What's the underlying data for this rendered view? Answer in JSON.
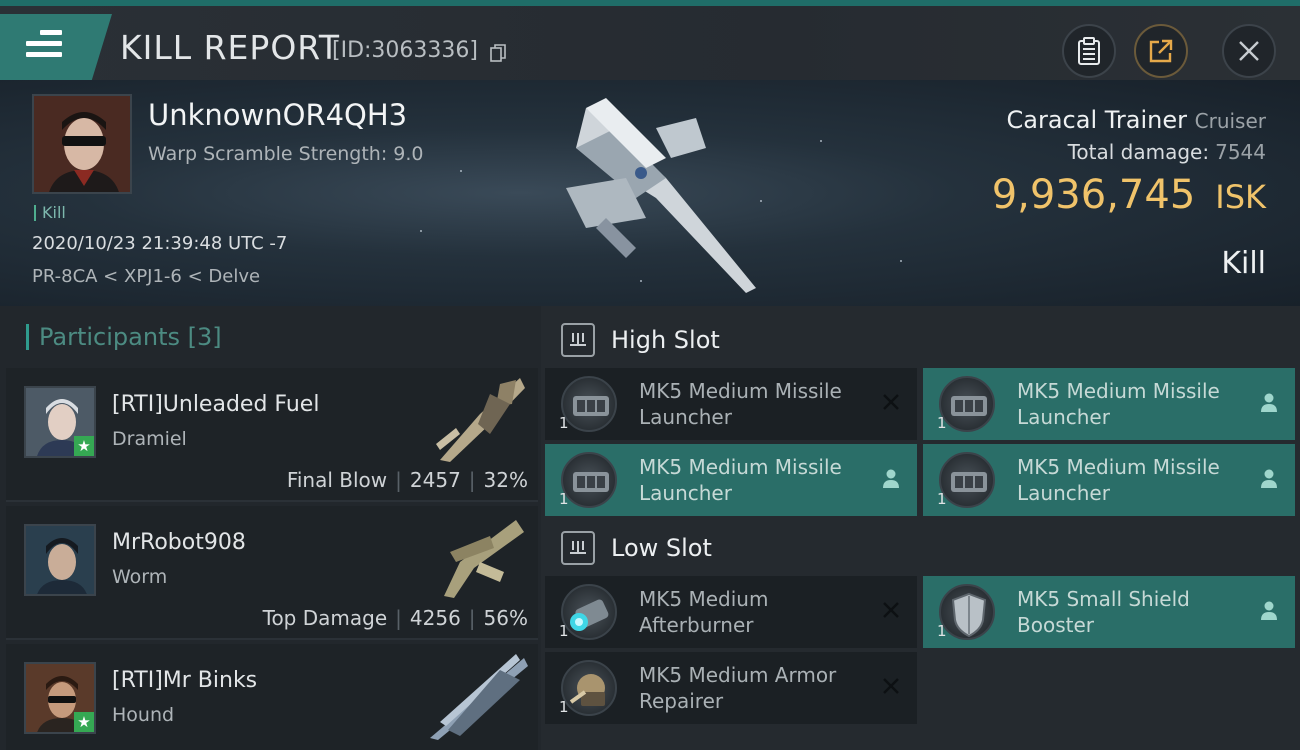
{
  "header": {
    "title": "KILL REPORT",
    "report_id": "[ID:3063336]"
  },
  "victim": {
    "name": "UnknownOR4QH3",
    "warp_scramble": "Warp Scramble Strength: 9.0",
    "tag": "Kill",
    "datetime": "2020/10/23 21:39:48 UTC -7",
    "location": "PR-8CA < XPJ1-6 < Delve",
    "ship_name": "Caracal Trainer",
    "ship_class": "Cruiser",
    "total_damage_label": "Total damage:",
    "total_damage": "7544",
    "isk_value": "9,936,745",
    "isk_unit": "ISK",
    "result": "Kill"
  },
  "participants": {
    "heading": "Participants [3]",
    "items": [
      {
        "name": "[RTI]Unleaded Fuel",
        "ship": "Dramiel",
        "role": "Final Blow",
        "damage": "2457",
        "percent": "32%"
      },
      {
        "name": "MrRobot908",
        "ship": "Worm",
        "role": "Top Damage",
        "damage": "4256",
        "percent": "56%"
      },
      {
        "name": "[RTI]Mr Binks",
        "ship": "Hound",
        "role": "",
        "damage": "",
        "percent": ""
      }
    ]
  },
  "slots": {
    "high": {
      "title": "High Slot",
      "modules": [
        {
          "name": "MK5 Medium Missile Launcher",
          "qty": "1",
          "status": "destroyed"
        },
        {
          "name": "MK5 Medium Missile Launcher",
          "qty": "1",
          "status": "dropped"
        },
        {
          "name": "MK5 Medium Missile Launcher",
          "qty": "1",
          "status": "dropped"
        },
        {
          "name": "MK5 Medium Missile Launcher",
          "qty": "1",
          "status": "dropped"
        }
      ]
    },
    "low": {
      "title": "Low Slot",
      "modules": [
        {
          "name": "MK5 Medium Afterburner",
          "qty": "1",
          "status": "destroyed"
        },
        {
          "name": "MK5 Small Shield Booster",
          "qty": "1",
          "status": "dropped"
        },
        {
          "name": "MK5 Medium Armor Repairer",
          "qty": "1",
          "status": "destroyed"
        }
      ]
    }
  },
  "colors": {
    "accent": "#2f7a73",
    "isk": "#f0c36a",
    "selected_module": "#2a6e68"
  },
  "icons": [
    "menu-icon",
    "copy-icon",
    "clipboard-icon",
    "share-icon",
    "close-icon",
    "slot-icon",
    "person-icon",
    "x-icon",
    "star-icon"
  ]
}
